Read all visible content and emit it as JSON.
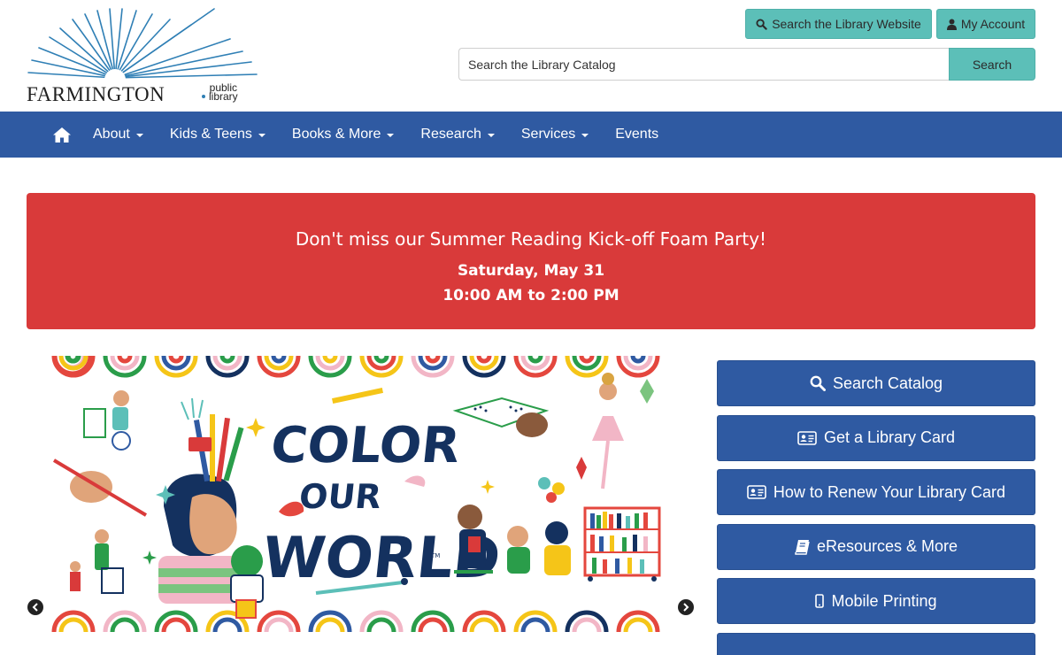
{
  "logo": {
    "name": "FARMINGTON",
    "sub_line1": "public",
    "sub_line2": "library"
  },
  "header": {
    "site_search_label": "Search the Library Website",
    "account_label": "My Account",
    "catalog_placeholder": "Search the Library Catalog",
    "catalog_button": "Search"
  },
  "nav": {
    "home_icon": "home-icon",
    "items": [
      {
        "label": "About",
        "dropdown": true
      },
      {
        "label": "Kids & Teens",
        "dropdown": true
      },
      {
        "label": "Books & More",
        "dropdown": true
      },
      {
        "label": "Research",
        "dropdown": true
      },
      {
        "label": "Services",
        "dropdown": true
      },
      {
        "label": "Events",
        "dropdown": false
      }
    ]
  },
  "alert": {
    "title": "Don't miss our Summer Reading Kick-off Foam Party!",
    "date": "Saturday, May 31",
    "time": "10:00 AM to 2:00 PM"
  },
  "carousel": {
    "slide_line1": "COLOR",
    "slide_line2": "OUR",
    "slide_line3": "WORLD",
    "slide_tm": "TM"
  },
  "quick_links": [
    {
      "label": "Search Catalog",
      "icon": "search-icon"
    },
    {
      "label": "Get a Library Card",
      "icon": "id-card-icon"
    },
    {
      "label": "How to Renew Your Library Card",
      "icon": "id-card-icon"
    },
    {
      "label": "eResources & More",
      "icon": "book-icon"
    },
    {
      "label": "Mobile Printing",
      "icon": "mobile-icon"
    }
  ],
  "colors": {
    "nav_blue": "#2f5aa2",
    "teal": "#5cbfb8",
    "alert_red": "#d93a3a"
  }
}
